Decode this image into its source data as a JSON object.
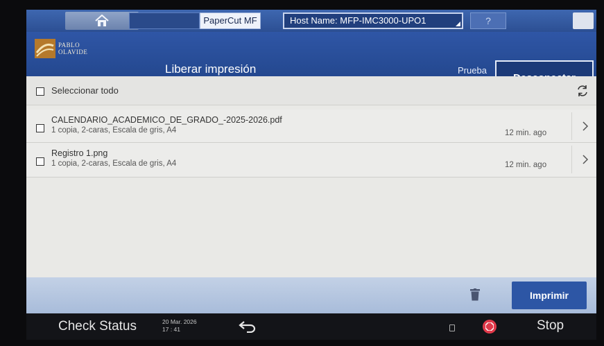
{
  "top_bar": {
    "home_icon": "home-icon",
    "app_name": "PaperCut MF",
    "host_name": "Host Name: MFP-IMC3000-UPO1",
    "help_label": "?",
    "sleep_icon": "moon-icon"
  },
  "header": {
    "logo_text_line1": "PABLO",
    "logo_text_line2": "OLAVIDE",
    "title": "Liberar impresión",
    "user_label": "Prueba",
    "disconnect_label": "Desconectar"
  },
  "list": {
    "select_all_label": "Seleccionar todo",
    "refresh_icon": "refresh-icon",
    "jobs": [
      {
        "name": "CALENDARIO_ACADEMICO_DE_GRADO_-2025-2026.pdf",
        "detail": "1 copia, 2-caras, Escala de gris, A4",
        "time": "12 min. ago"
      },
      {
        "name": "Registro 1.png",
        "detail": "1 copia, 2-caras, Escala de gris, A4",
        "time": "12 min. ago"
      }
    ]
  },
  "actions": {
    "delete_icon": "trash-icon",
    "print_label": "Imprimir"
  },
  "device": {
    "check_status_label": "Check Status",
    "date": "20 Mar. 2026",
    "time": "17 : 41",
    "back_icon": "back-arrow-icon",
    "stop_label": "Stop"
  },
  "colors": {
    "header_blue": "#2f56a6",
    "print_button": "#2d56a5",
    "stop_red": "#e0394a"
  }
}
